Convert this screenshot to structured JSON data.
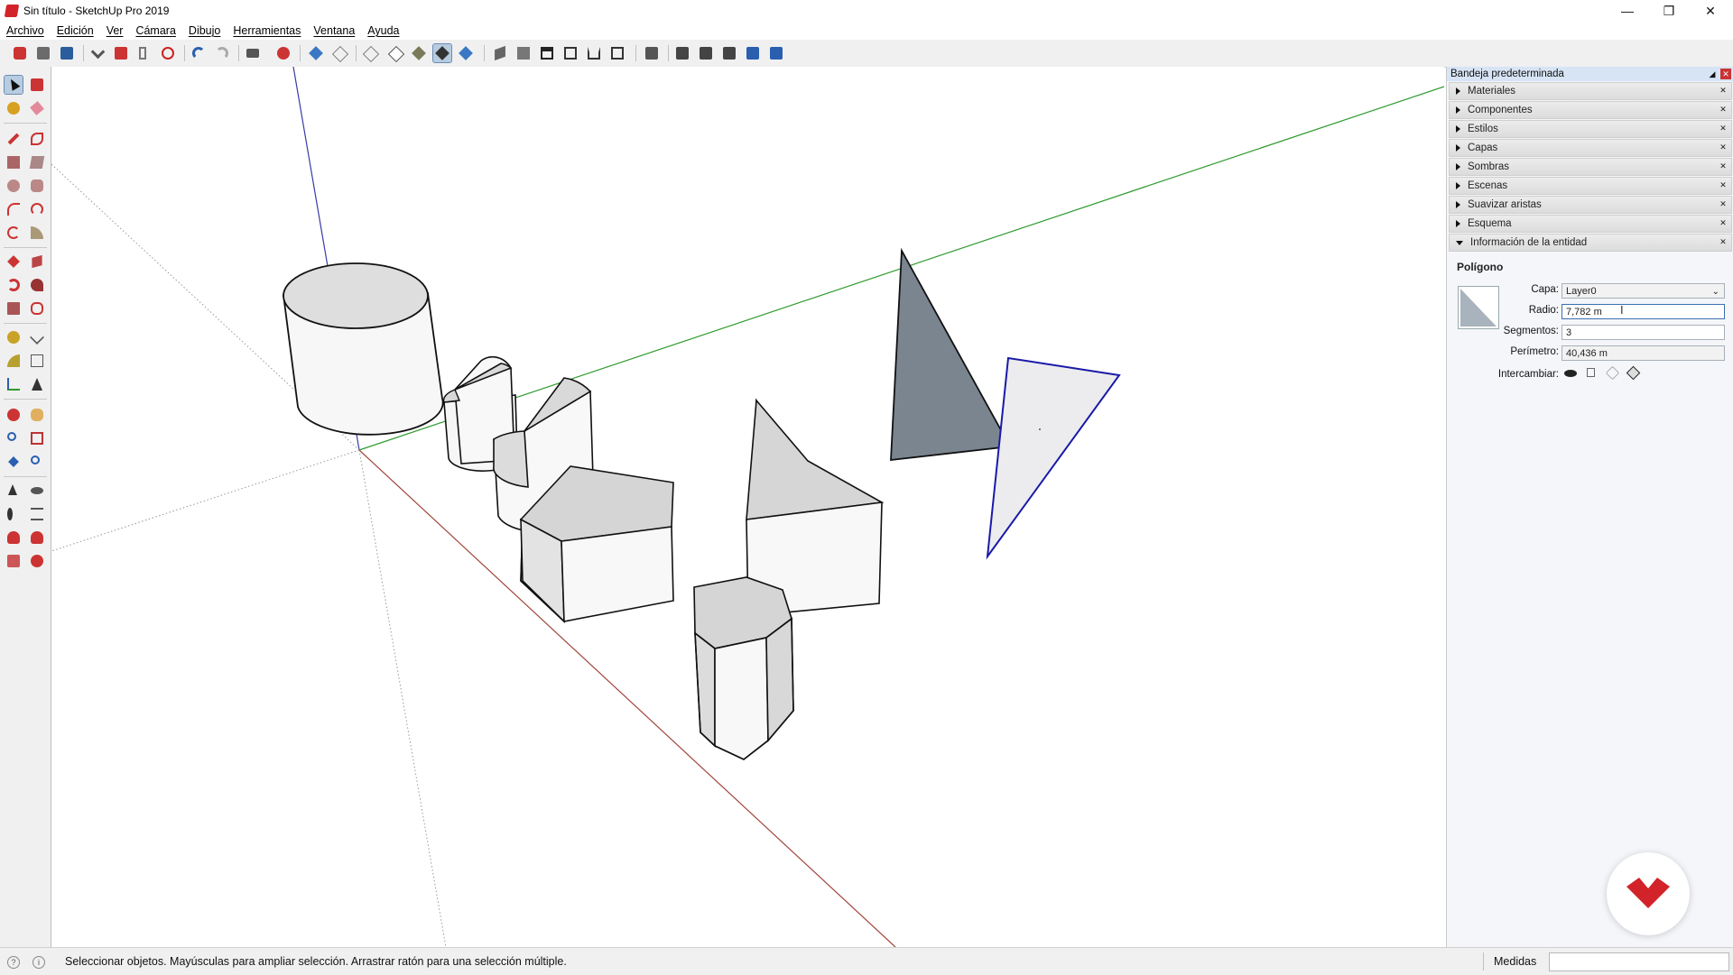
{
  "window": {
    "title": "Sin título - SketchUp Pro 2019",
    "controls": [
      "—",
      "❐",
      "✕"
    ]
  },
  "menu": [
    "Archivo",
    "Edición",
    "Ver",
    "Cámara",
    "Dibujo",
    "Herramientas",
    "Ventana",
    "Ayuda"
  ],
  "tray": {
    "title": "Bandeja predeterminada",
    "panels": [
      {
        "label": "Materiales"
      },
      {
        "label": "Componentes"
      },
      {
        "label": "Estilos"
      },
      {
        "label": "Capas"
      },
      {
        "label": "Sombras"
      },
      {
        "label": "Escenas"
      },
      {
        "label": "Suavizar aristas"
      },
      {
        "label": "Esquema"
      }
    ],
    "entity_panel": {
      "label": "Información de la entidad",
      "entity_type": "Polígono",
      "capa_label": "Capa:",
      "capa_value": "Layer0",
      "radio_label": "Radio:",
      "radio_value": "7,782 m",
      "segmentos_label": "Segmentos:",
      "segmentos_value": "3",
      "perimetro_label": "Perímetro:",
      "perimetro_value": "40,436 m",
      "intercambiar_label": "Intercambiar:"
    }
  },
  "status": {
    "message": "Seleccionar objetos. Mayúsculas para ampliar selección. Arrastrar ratón para una selección múltiple.",
    "measures_label": "Medidas",
    "measures_value": ""
  },
  "colors": {
    "accent_red": "#d2232a",
    "selection_blue": "#1a1aa8",
    "axis_green": "#2e9b2e",
    "axis_red": "#a0453a",
    "axis_blue": "#3a3aa8",
    "tray_header": "#d7e4f5"
  }
}
